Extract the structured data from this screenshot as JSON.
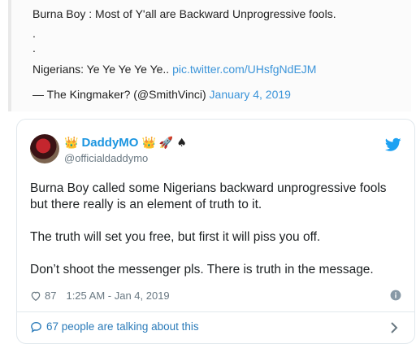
{
  "quote": {
    "line1": "Burna Boy : Most of Y'all are Backward Unprogressive fools.",
    "dot1": ".",
    "dot2": ".",
    "line4_text": "Nigerians: Ye Ye Ye Ye Ye.. ",
    "line4_link": "pic.twitter.com/UHsfgNdEJM",
    "attribution": "— The Kingmaker? (@SmithVinci) ",
    "date_link": "January 4, 2019"
  },
  "tweet": {
    "display_name": "DaddyMO",
    "handle": "@officialdaddymo",
    "emoji_crown": "👑",
    "emoji_rocket": "🚀",
    "emoji_spade": "♠",
    "paragraphs": [
      "Burna Boy called some Nigerians backward unprogressive fools but there really is an element of truth to it.",
      "The truth will set you free, but first it will piss you off.",
      "Don’t shoot the messenger pls. There is truth in the message."
    ],
    "likes": "87",
    "timestamp": "1:25 AM - Jan 4, 2019",
    "talking": "67 people are talking about this"
  },
  "colors": {
    "link": "#3b94d9",
    "name": "#1b95e0",
    "muted": "#697882",
    "border": "#e1e8ed"
  },
  "icons": [
    "heart-icon",
    "info-icon",
    "comment-bubble-icon",
    "chevron-right-icon",
    "twitter-bird-icon",
    "avatar"
  ]
}
